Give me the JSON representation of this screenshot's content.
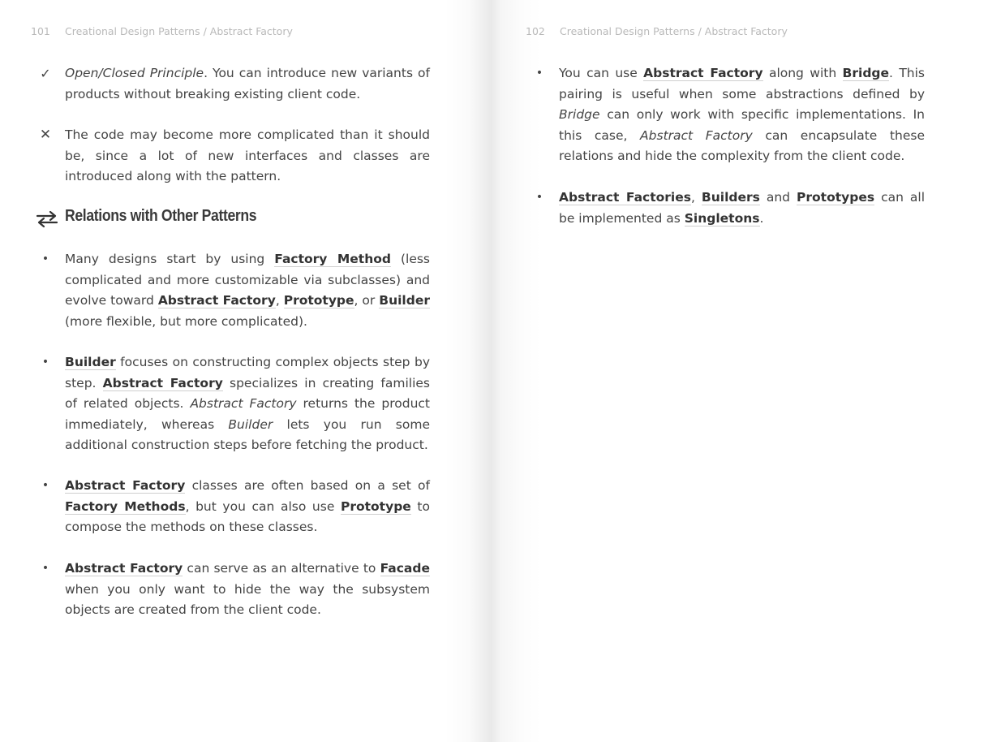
{
  "left_page": {
    "page_number": "101",
    "running_head": "Creational Design Patterns / Abstract Factory",
    "pro": {
      "term": "Open/Closed Principle",
      "text": ". You can introduce new variants of products without breaking existing client code."
    },
    "con": {
      "text": "The code may become more complicated than it should be, since a lot of new interfaces and classes are introduced along with the pattern."
    },
    "section_title": "Relations with Other Patterns",
    "bullets": [
      {
        "t1": "Many designs start by using ",
        "l1": "Factory Method",
        "t2": " (less complicated and more customizable via subclasses) and evolve toward ",
        "l2": "Abstract Factory",
        "t3": ", ",
        "l3": "Prototype",
        "t4": ", or ",
        "l4": "Builder",
        "t5": " (more flexible, but more complicated)."
      },
      {
        "l1": "Builder",
        "t1": " focuses on constructing complex objects step by step. ",
        "l2": "Abstract Factory",
        "t2": " specializes in creating families of related objects. ",
        "e1": "Abstract Factory",
        "t3": " returns the product immediately, whereas ",
        "e2": "Builder",
        "t4": " lets you run some additional construction steps before fetching the product."
      },
      {
        "l1": "Abstract Factory",
        "t1": " classes are often based on a set of ",
        "l2": "Factory Methods",
        "t2": ", but you can also use ",
        "l3": "Prototype",
        "t3": " to compose the methods on these classes."
      },
      {
        "l1": "Abstract Factory",
        "t1": " can serve as an alternative to ",
        "l2": "Facade",
        "t2": " when you only want to hide the way the subsystem objects are created from the client code."
      }
    ]
  },
  "right_page": {
    "page_number": "102",
    "running_head": "Creational Design Patterns / Abstract Factory",
    "bullets": [
      {
        "t1": "You can use ",
        "l1": "Abstract Factory",
        "t2": " along with ",
        "l2": "Bridge",
        "t3": ". This pairing is useful when some abstractions defined by ",
        "e1": "Bridge",
        "t4": " can only work with specific implementations. In this case, ",
        "e2": "Abstract Factory",
        "t5": " can encapsulate these relations and hide the complexity from the client code."
      },
      {
        "l1": "Abstract Factories",
        "t1": ", ",
        "l2": "Builders",
        "t2": " and ",
        "l3": "Prototypes",
        "t3": " can all be implemented as ",
        "l4": "Singletons",
        "t4": "."
      }
    ]
  },
  "icons": {
    "pro_marker": "checkmark-icon",
    "con_marker": "cross-icon",
    "section_marker": "two-way-arrows-icon"
  },
  "colors": {
    "text": "#444444",
    "running_head": "#b9b9b9",
    "link_underline": "#cfcfcf"
  }
}
